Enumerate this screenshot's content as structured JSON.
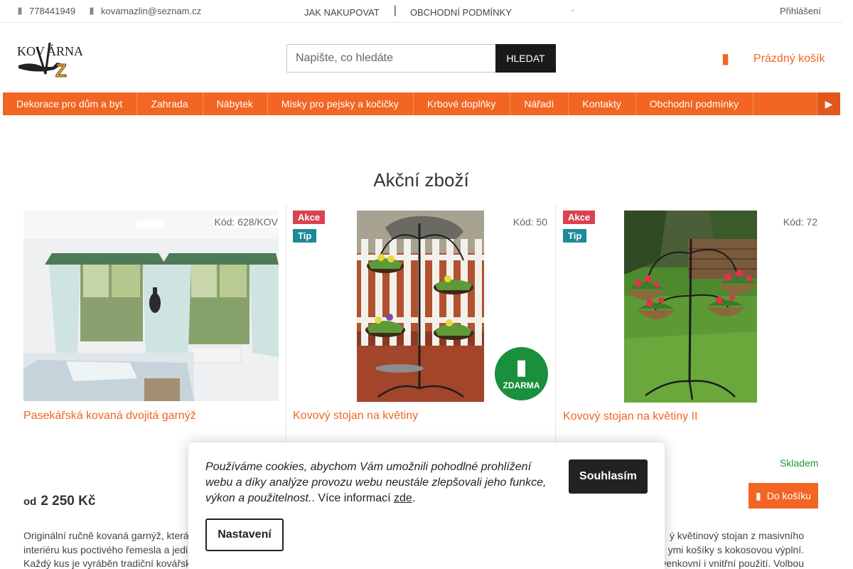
{
  "topbar": {
    "phone": "778441949",
    "email": "kovarnazlin@seznam.cz",
    "links": [
      "JAK NAKUPOVAT",
      "OBCHODNÍ PODMÍNKY"
    ],
    "login": "Přihlášení"
  },
  "logo": {
    "text_top": "KOV",
    "text_right": "ÁRNA",
    "initial": "Z"
  },
  "search": {
    "placeholder": "Napište, co hledáte",
    "button": "HLEDAT"
  },
  "cart": {
    "label": "Prázdný košík"
  },
  "nav": {
    "items": [
      "Dekorace pro dům a byt",
      "Zahrada",
      "Nábytek",
      "Misky pro pejsky a kočičky",
      "Krbové doplňky",
      "Nářadí",
      "Kontakty",
      "Obchodní podmínky"
    ]
  },
  "section": {
    "title": "Akční zboží"
  },
  "products": [
    {
      "code": "Kód: 628/KOV",
      "name": "Pasekářská kovaná dvojitá garnýž",
      "price_prefix": "od",
      "price": "2 250 Kč",
      "desc": [
        "Originální ručně kovaná garnýž, která",
        "interiéru kus poctivého řemesla a jedi",
        "Každý kus je vyráběn tradiční kovářsk"
      ]
    },
    {
      "code": "Kód: 50",
      "flags": [
        "Akce",
        "Tip"
      ],
      "name": "Kovový stojan na květiny",
      "free_shipping": "ZDARMA"
    },
    {
      "code": "Kód: 72",
      "flags": [
        "Akce",
        "Tip"
      ],
      "name": "Kovový stojan na květiny II",
      "stock": "Skladem",
      "add_to_cart": "Do košíku",
      "desc": [
        "ý květinový stojan z masivního",
        "ymi košíky s kokosovou výplní.",
        "venkovní i vnitřní použití. Volbou"
      ]
    }
  ],
  "cookie": {
    "text": "Používáme cookies, abychom Vám umožnili pohodlné prohlížení webu a díky analýze provozu webu neustále zlepšovali jeho funkce, výkon a použitelnost.",
    "more_prefix": ". Více informací ",
    "more_link": "zde",
    "more_suffix": ".",
    "accept": "Souhlasím",
    "settings": "Nastavení"
  },
  "colors": {
    "accent": "#f26522",
    "akce": "#d9434f",
    "tip": "#1d8a99",
    "free_shipping": "#1a8f3c",
    "dark": "#1a1a1a"
  },
  "icons": [
    "phone-icon",
    "mail-icon",
    "search-icon",
    "cart-icon",
    "chevron-icon",
    "truck-icon",
    "cart-small-icon"
  ]
}
